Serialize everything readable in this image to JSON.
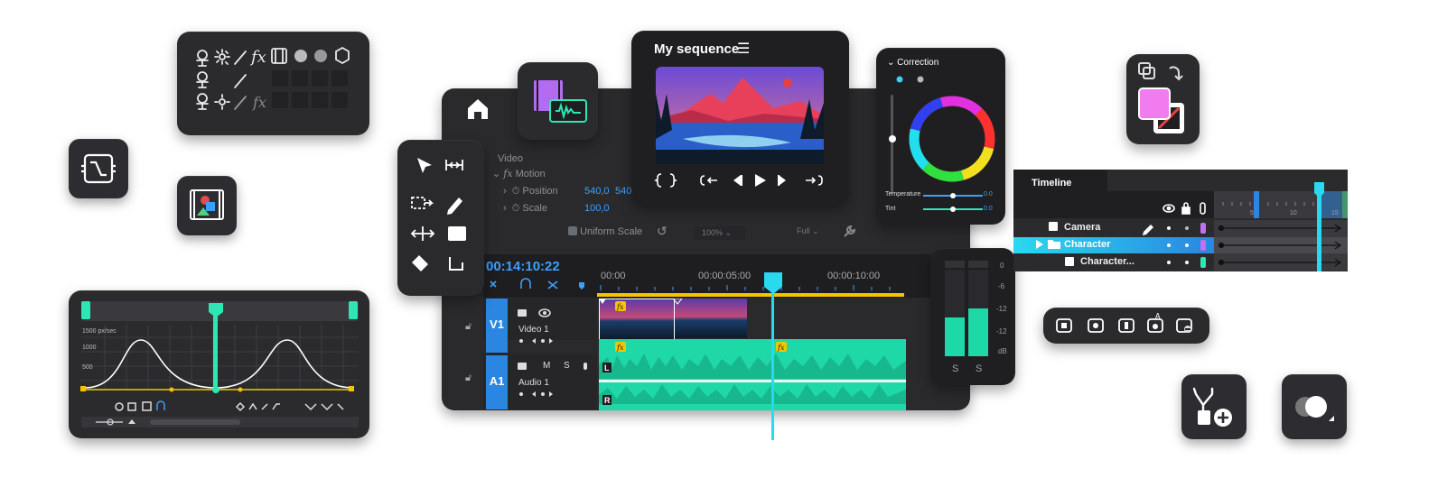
{
  "sequence": {
    "title": "My sequence"
  },
  "effects": {
    "section": "Video",
    "motion_label": "Motion",
    "position_label": "Position",
    "position_x": "540,0",
    "position_y": "540,",
    "scale_label": "Scale",
    "scale_value": "100,0",
    "uniform_scale_label": "Uniform Scale",
    "zoom": "100%",
    "quality": "Full"
  },
  "timeline_main": {
    "timecode": "00:14:10:22",
    "ruler": [
      "00:00",
      "00:00:05:00",
      "00:00:10:00"
    ],
    "tracks": [
      {
        "id": "V1",
        "name": "Video 1"
      },
      {
        "id": "A1",
        "name": "Audio 1",
        "m": "M",
        "s": "S"
      }
    ],
    "channel_left": "L",
    "channel_right": "R"
  },
  "meter": {
    "scale": [
      "0",
      "-6",
      "-12",
      "-12",
      "dB"
    ],
    "solo_left": "S",
    "solo_right": "S",
    "levels": [
      0.45,
      0.55
    ]
  },
  "correction": {
    "title": "Correction",
    "temperature_label": "Temperature",
    "temperature_value": "0.0",
    "tint_label": "Tint",
    "tint_value": "0.0"
  },
  "layers": {
    "title": "Timeline",
    "ruler": [
      "5",
      "10",
      "15"
    ],
    "rows": [
      {
        "name": "Camera"
      },
      {
        "name": "Character"
      },
      {
        "name": "Character..."
      }
    ]
  },
  "graph": {
    "y_labels": [
      "1500 px/sec",
      "1000",
      "500"
    ]
  },
  "colors": {
    "accent_blue": "#3aa0ff",
    "accent_teal": "#2ee6b4",
    "panel": "#2b2b2e",
    "clip_yellow": "#f5c400",
    "swatch_pink": "#f07cf0"
  }
}
